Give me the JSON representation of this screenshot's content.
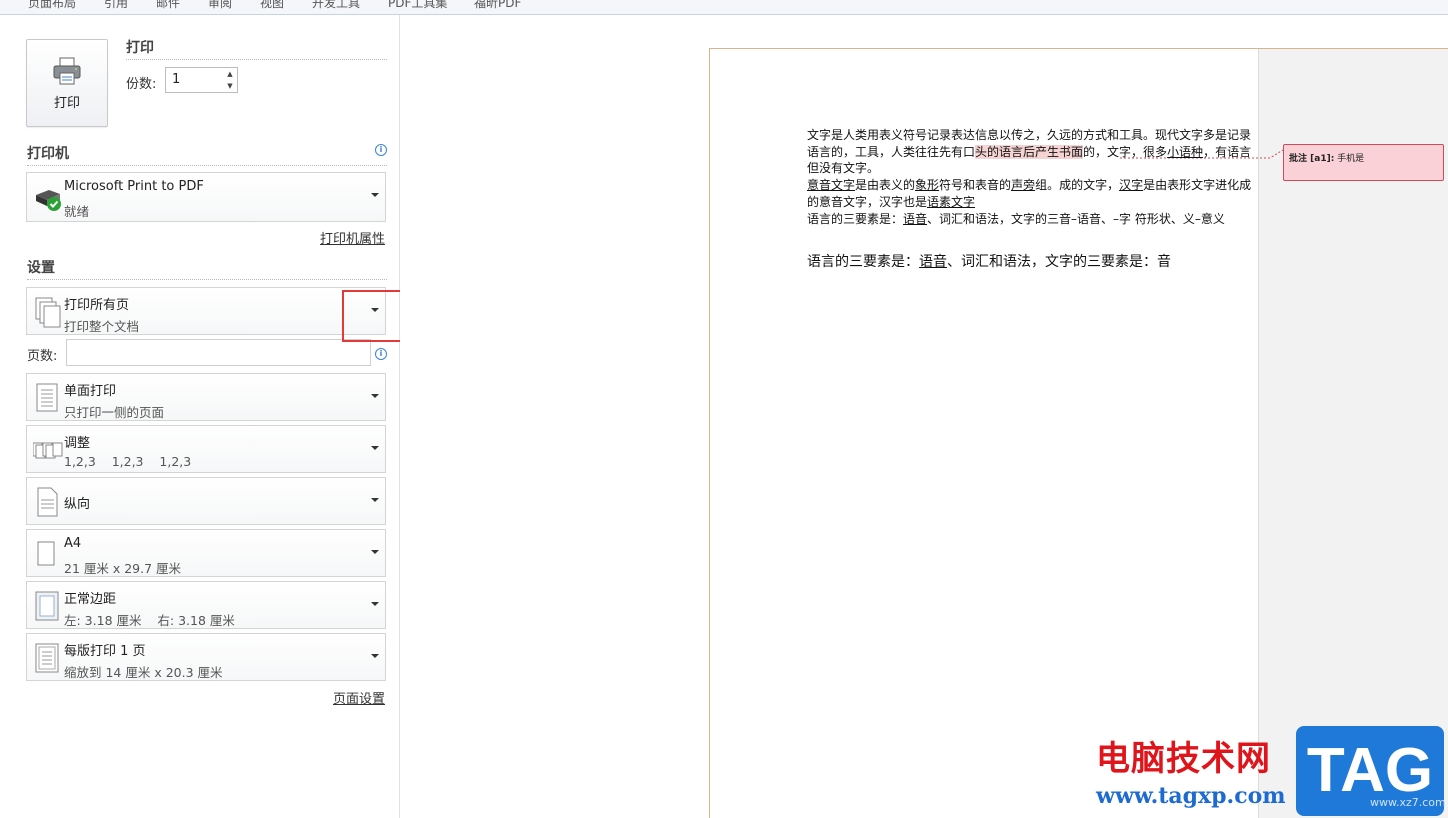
{
  "ribbon": {
    "tabs": [
      "页面布局",
      "引用",
      "邮件",
      "审阅",
      "视图",
      "开发工具",
      "PDF工具集",
      "福昕PDF"
    ]
  },
  "print": {
    "button_label": "打印",
    "section_title": "打印",
    "copies_label": "份数:",
    "copies_value": "1"
  },
  "printer": {
    "section_title": "打印机",
    "name": "Microsoft Print to PDF",
    "status": "就绪",
    "properties_link": "打印机属性"
  },
  "settings": {
    "section_title": "设置",
    "pages_label": "页数:",
    "pages_value": "",
    "items": [
      {
        "line1": "打印所有页",
        "line2": "打印整个文档",
        "icon": "pages-icon"
      },
      {
        "line1": "单面打印",
        "line2": "只打印一侧的页面",
        "icon": "single-side-icon"
      },
      {
        "line1": "调整",
        "line2": "1,2,3    1,2,3    1,2,3",
        "icon": "collate-icon"
      },
      {
        "line1": "纵向",
        "line2": "",
        "icon": "portrait-icon"
      },
      {
        "line1": "A4",
        "line2": "21 厘米 x 29.7 厘米",
        "icon": "paper-size-icon"
      },
      {
        "line1": "正常边距",
        "line2": "左: 3.18 厘米    右: 3.18 厘米",
        "icon": "margins-icon"
      },
      {
        "line1": "每版打印 1 页",
        "line2": "缩放到 14 厘米 x 20.3 厘米",
        "icon": "pages-per-sheet-icon"
      }
    ],
    "page_setup_link": "页面设置"
  },
  "preview": {
    "p1_a": "文字是人类用表义符号记录表达信息以传之，久远的方式和工具。现代文字多是记录语言的，工具，人类往往先有口",
    "p1_hl": "头的语言后产生书面",
    "p1_b": "的，文字，很多",
    "p1_ul": "小语种",
    "p1_c": "，有语言但没有文字。",
    "p2_u1": "意音文字",
    "p2_a": "是由表义的",
    "p2_u2": "象形",
    "p2_b": "符号和表音的",
    "p2_u3": "声旁",
    "p2_c": "组。成的文字，",
    "p2_u4": "汉字",
    "p2_d": "是由表形文字进化成的意音文字，汉字也是",
    "p2_u5": "语素文字",
    "p3": "语言的三要素是：语音、词汇和语法，文字的三音–语音、–字 符形状、义–意义",
    "p3_pre": "语言的三要素是：",
    "p3_u": "语音",
    "p3_post": "、词汇和语法，文字的三音–语音、–字 符形状、义–意义",
    "big_pre": "语言的三要素是：",
    "big_u": "语音",
    "big_post": "、词汇和语法，文字的三要素是：音",
    "comment_label": "批注 [a1]:",
    "comment_text": " 手机是"
  },
  "watermark": {
    "cn": "电脑技术网",
    "url": "www.tagxp.com",
    "tag": "TAG",
    "small": "www.xz7.com"
  },
  "colors": {
    "highlight": "#e23a3a",
    "comment_bg": "#f9d1d6",
    "info": "#3a84d3"
  }
}
